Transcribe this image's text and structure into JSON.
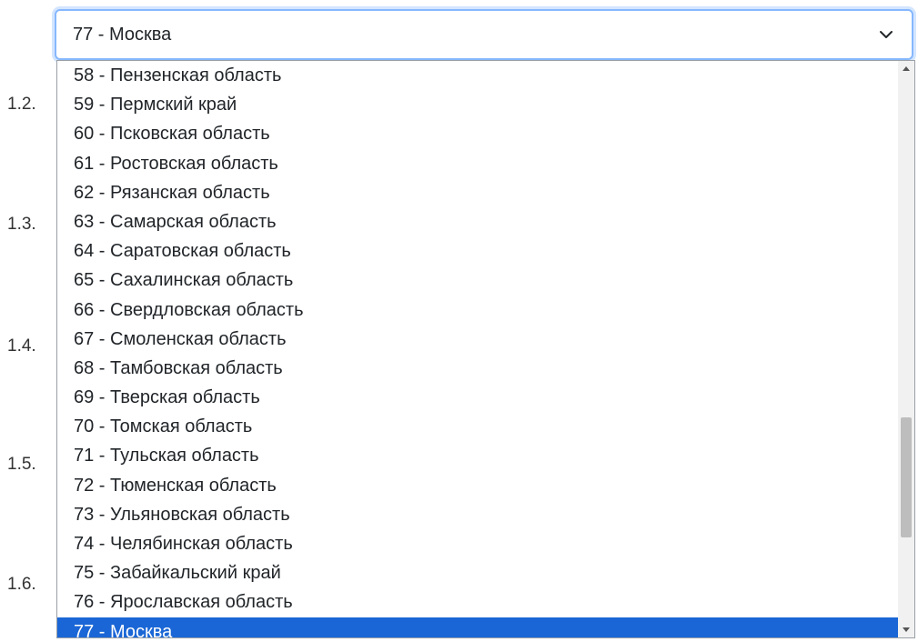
{
  "section_numbers": [
    "1.2.",
    "1.3.",
    "1.4.",
    "1.5.",
    "1.6."
  ],
  "region_select": {
    "value": "77 - Москва",
    "scroll_position_fraction": 0.7,
    "options": [
      "58 - Пензенская область",
      "59 - Пермский край",
      "60 - Псковская область",
      "61 - Ростовская область",
      "62 - Рязанская область",
      "63 - Самарская область",
      "64 - Саратовская область",
      "65 - Сахалинская область",
      "66 - Свердловская область",
      "67 - Смоленская область",
      "68 - Тамбовская область",
      "69 - Тверская область",
      "70 - Томская область",
      "71 - Тульская область",
      "72 - Тюменская область",
      "73 - Ульяновская область",
      "74 - Челябинская область",
      "75 - Забайкальский край",
      "76 - Ярославская область",
      "77 - Москва"
    ],
    "selected_index": 19
  },
  "icons": {
    "chevron": "chevron-down-icon",
    "scroll_up": "scroll-up-arrow-icon",
    "scroll_down": "scroll-down-arrow-icon"
  },
  "colors": {
    "selected_background": "#1a66d6",
    "focus_border": "#86b7fe"
  }
}
